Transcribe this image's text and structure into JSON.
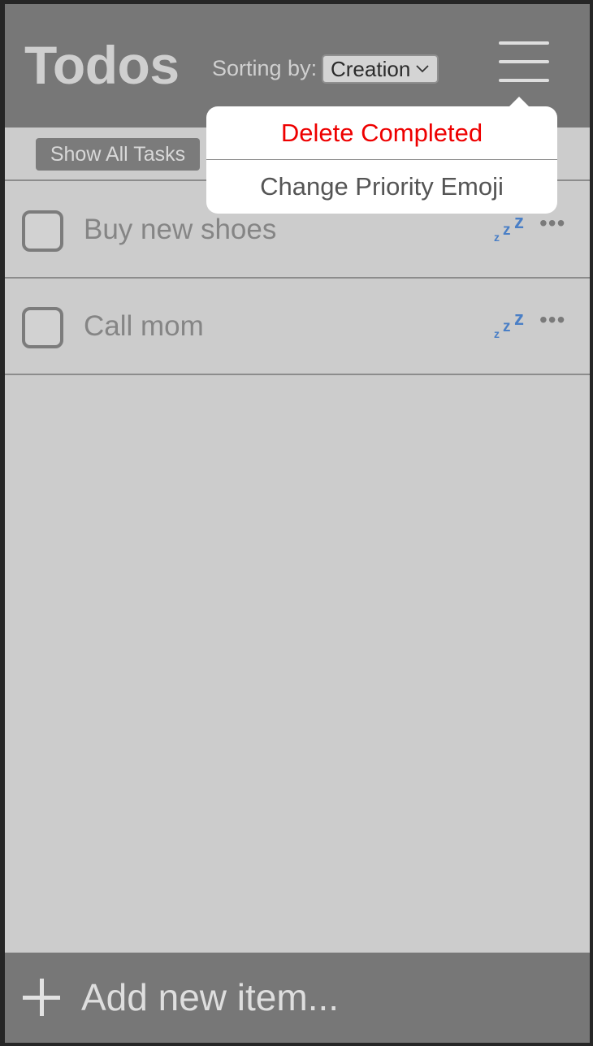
{
  "header": {
    "title": "Todos",
    "sort_label": "Sorting by:",
    "sort_value": "Creation",
    "menu_icon": "hamburger-menu-icon"
  },
  "filter": {
    "button_label": "Show All Tasks"
  },
  "menu": {
    "items": [
      {
        "label": "Delete Completed",
        "color": "#ee0000"
      },
      {
        "label": "Change Priority Emoji",
        "color": "#555555"
      }
    ]
  },
  "todos": [
    {
      "text": "Buy new shoes",
      "checked": false,
      "priority_icon": "zzz-sleep-icon",
      "more_label": "•••"
    },
    {
      "text": "Call mom",
      "checked": false,
      "priority_icon": "zzz-sleep-icon",
      "more_label": "•••"
    }
  ],
  "footer": {
    "add_placeholder": "Add new item..."
  },
  "colors": {
    "header_bg": "#777777",
    "body_bg": "#cccccc",
    "delete_red": "#ee0000",
    "zzz_blue": "#4a7fc6"
  }
}
